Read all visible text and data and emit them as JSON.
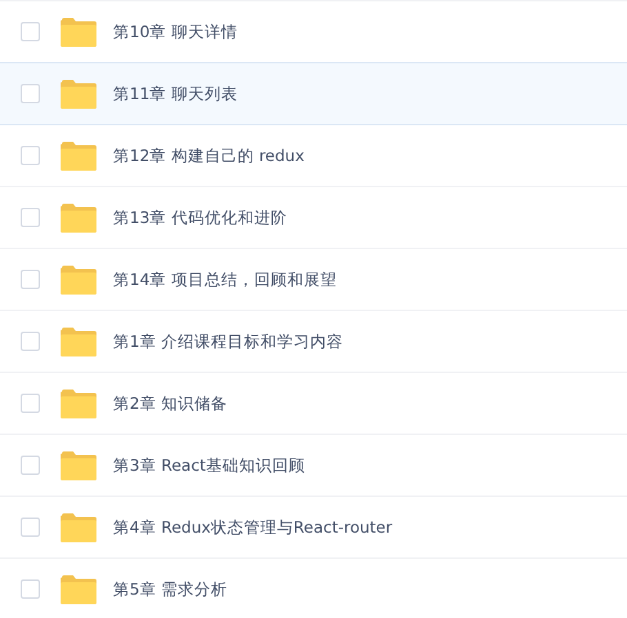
{
  "rows": [
    {
      "name": "第10章 聊天详情",
      "selected": false,
      "checked": false
    },
    {
      "name": "第11章 聊天列表",
      "selected": true,
      "checked": false
    },
    {
      "name": "第12章 构建自己的 redux",
      "selected": false,
      "checked": false
    },
    {
      "name": "第13章 代码优化和进阶",
      "selected": false,
      "checked": false
    },
    {
      "name": "第14章 项目总结，回顾和展望",
      "selected": false,
      "checked": false
    },
    {
      "name": "第1章 介绍课程目标和学习内容",
      "selected": false,
      "checked": false
    },
    {
      "name": "第2章 知识储备",
      "selected": false,
      "checked": false
    },
    {
      "name": "第3章 React基础知识回顾",
      "selected": false,
      "checked": false
    },
    {
      "name": "第4章 Redux状态管理与React-router",
      "selected": false,
      "checked": false
    },
    {
      "name": "第5章 需求分析",
      "selected": false,
      "checked": false
    }
  ]
}
